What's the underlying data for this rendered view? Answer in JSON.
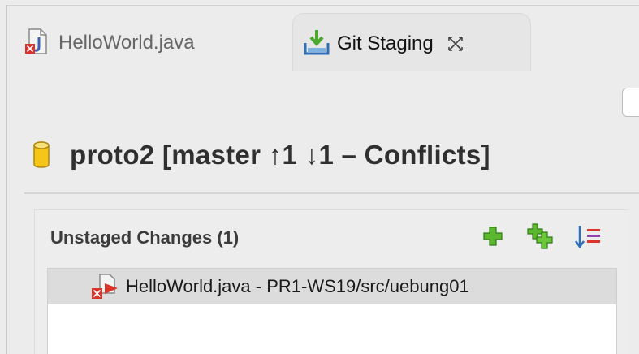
{
  "tabs": [
    {
      "label": "HelloWorld.java",
      "icon": "java-file-conflict-icon",
      "active": false
    },
    {
      "label": "Git Staging",
      "icon": "git-staging-icon",
      "active": true,
      "close_icon": "close-icon"
    }
  ],
  "repository": {
    "icon": "repository-icon",
    "title": "proto2 [master ↑1 ↓1 – Conflicts]"
  },
  "unstaged": {
    "title": "Unstaged Changes (1)",
    "buttons": [
      "add-to-index-icon",
      "add-all-to-index-icon",
      "sort-icon"
    ],
    "items": [
      {
        "label": "HelloWorld.java - PR1-WS19/src/uebung01",
        "icon": "java-file-conflict-icon"
      }
    ]
  },
  "colors": {
    "background": "#ececec",
    "selected_row": "#dcdcdc",
    "add_green": "#5bb82e",
    "conflict_red": "#d9342b"
  }
}
